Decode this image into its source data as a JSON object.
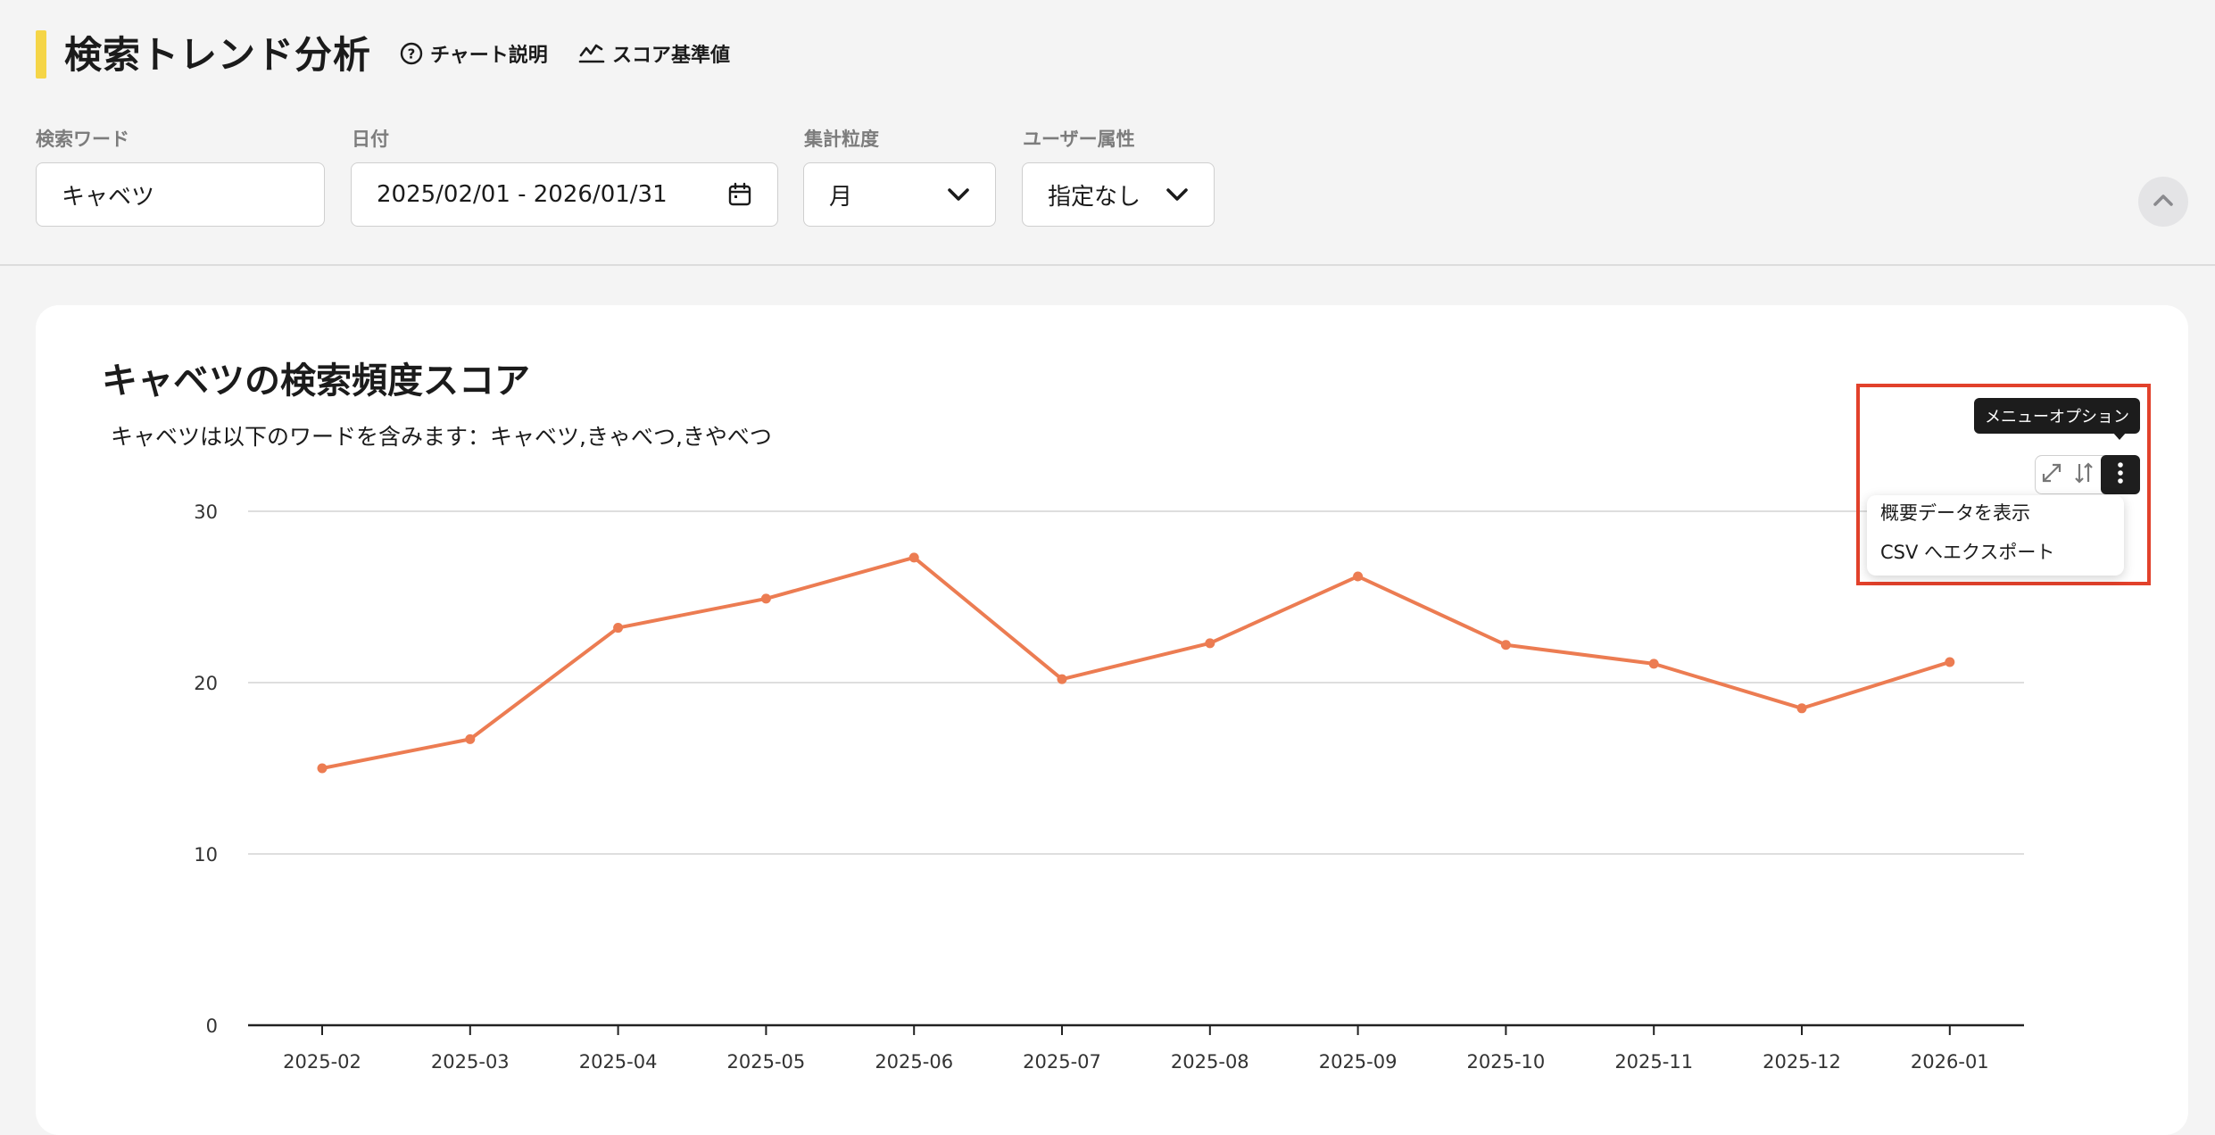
{
  "header": {
    "title": "検索トレンド分析",
    "links": [
      {
        "label": "チャート説明",
        "icon": "question-circle-icon"
      },
      {
        "label": "スコア基準値",
        "icon": "trend-line-icon"
      }
    ],
    "accent_color": "#f5d547"
  },
  "filters": {
    "keyword": {
      "label": "検索ワード",
      "value": "キャベツ"
    },
    "date": {
      "label": "日付",
      "value": "2025/02/01 - 2026/01/31",
      "icon": "calendar-icon"
    },
    "granularity": {
      "label": "集計粒度",
      "value": "月",
      "icon": "chevron-down-icon"
    },
    "attribute": {
      "label": "ユーザー属性",
      "value": "指定なし",
      "icon": "chevron-down-icon"
    }
  },
  "chart": {
    "tooltip": "メニューオプション",
    "menu": [
      "概要データを表示",
      "CSV へエクスポート"
    ],
    "highlight_color": "#e2412b"
  },
  "chart_data": {
    "type": "line",
    "title": "キャベツの検索頻度スコア",
    "subtitle": "キャベツは以下のワードを含みます：キャベツ,きゃべつ,きやべつ",
    "xlabel": "",
    "ylabel": "",
    "x": [
      "2025-02",
      "2025-03",
      "2025-04",
      "2025-05",
      "2025-06",
      "2025-07",
      "2025-08",
      "2025-09",
      "2025-10",
      "2025-11",
      "2025-12",
      "2026-01"
    ],
    "series": [
      {
        "values": [
          15.0,
          16.7,
          23.2,
          24.9,
          27.3,
          20.2,
          22.3,
          26.2,
          22.2,
          21.1,
          18.5,
          21.2
        ],
        "color": "#ec7c52"
      }
    ],
    "ylim": [
      0,
      30
    ],
    "yticks": [
      0,
      10,
      20,
      30
    ],
    "grid": true,
    "legend": "none"
  }
}
